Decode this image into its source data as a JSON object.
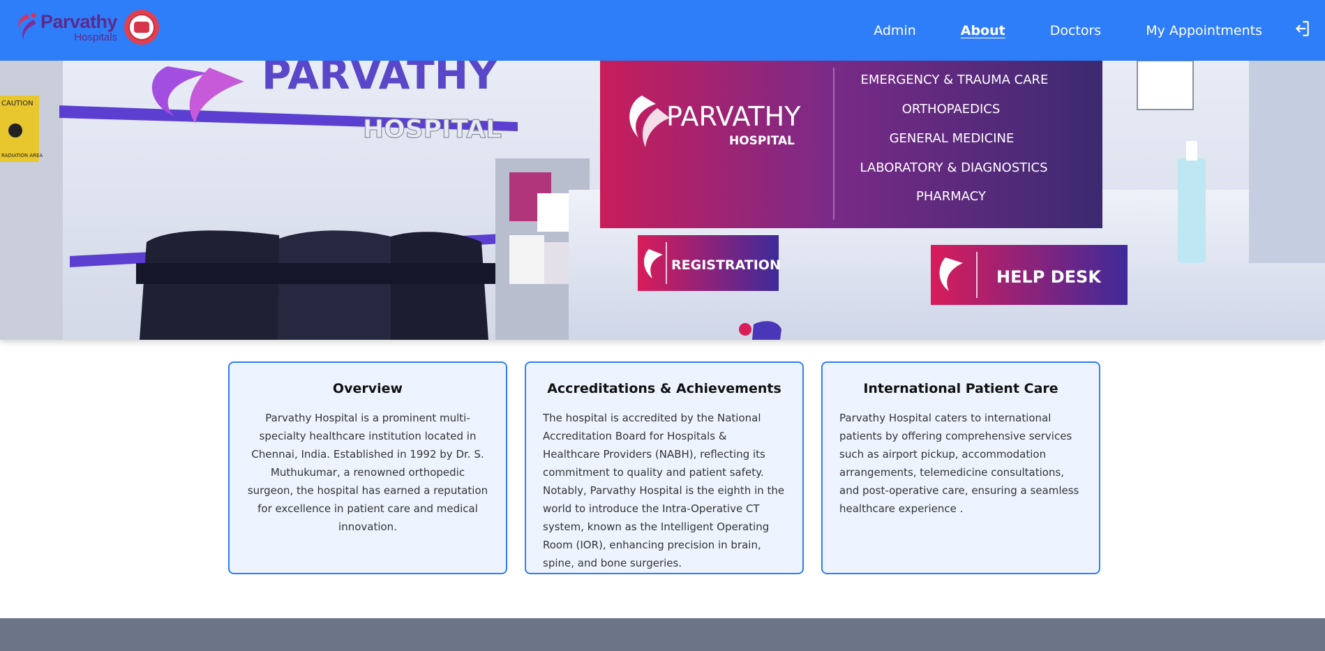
{
  "brand": {
    "name": "Parvathy",
    "sub": "Hospitals",
    "colors": {
      "primary": "#2f7ef9",
      "brand_purple": "#5b2a8c",
      "brand_pink": "#e0305a",
      "card_bg": "#edf4ff"
    }
  },
  "nav": {
    "items": [
      {
        "label": "Admin",
        "active": false
      },
      {
        "label": "About",
        "active": true
      },
      {
        "label": "Doctors",
        "active": false
      },
      {
        "label": "My Appointments",
        "active": false
      }
    ],
    "logout_icon": "logout-icon"
  },
  "hero": {
    "wall_sign_main": "PARVATHY",
    "wall_sign_sub": "HOSPITAL",
    "board_name": "PARVATHY",
    "board_sub": "HOSPITAL",
    "services": [
      "EMERGENCY & TRAUMA CARE",
      "ORTHOPAEDICS",
      "GENERAL MEDICINE",
      "LABORATORY & DIAGNOSTICS",
      "PHARMACY"
    ],
    "registration": "REGISTRATION",
    "helpdesk": "HELP DESK",
    "caution": "CAUTION",
    "radiation": "RADIATION AREA"
  },
  "cards": [
    {
      "title": "Overview",
      "text": "Parvathy Hospital is a prominent multi-specialty healthcare institution located in Chennai, India. Established in 1992 by Dr. S. Muthukumar, a renowned orthopedic surgeon, the hospital has earned a reputation for excellence in patient care and medical innovation."
    },
    {
      "title": "Accreditations & Achievements",
      "text": "The hospital is accredited by the National Accreditation Board for Hospitals & Healthcare Providers (NABH), reflecting its commitment to quality and patient safety. Notably, Parvathy Hospital is the eighth in the world to introduce the Intra-Operative CT system, known as the Intelligent Operating Room (IOR), enhancing precision in brain, spine, and bone surgeries."
    },
    {
      "title": "International Patient Care",
      "text": "Parvathy Hospital caters to international patients by offering comprehensive services such as airport pickup, accommodation arrangements, telemedicine consultations, and post-operative care, ensuring a seamless healthcare experience ."
    }
  ]
}
